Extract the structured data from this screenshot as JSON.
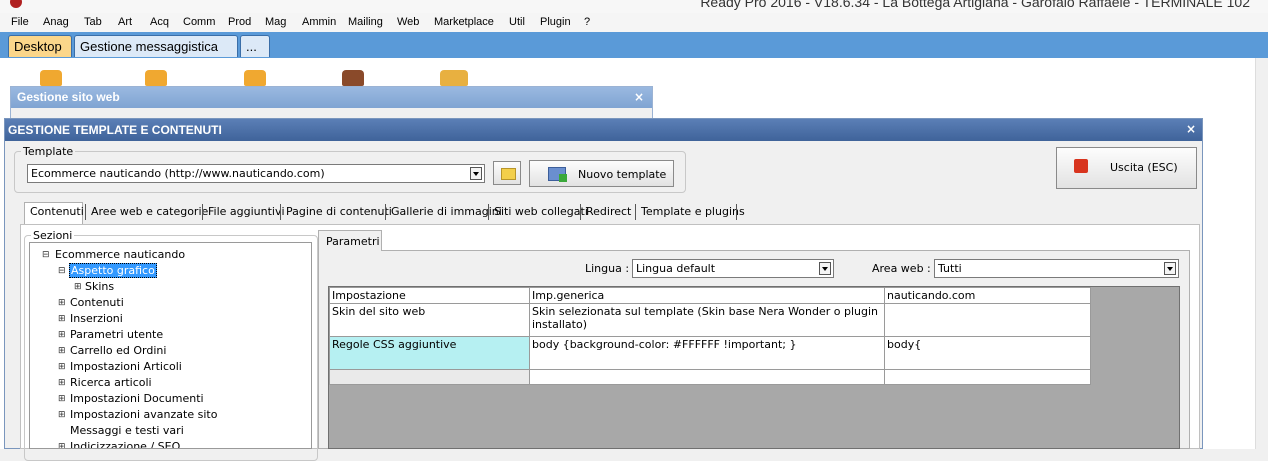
{
  "app": {
    "title": "Ready Pro 2016 - V18.6.34 - La Bottega Artigiana - Garofalo Raffaele - TERMINALE 102"
  },
  "menu": [
    "File",
    "Anag",
    "Tab",
    "Art",
    "Acq",
    "Comm",
    "Prod",
    "Mag",
    "Ammin",
    "Mailing",
    "Web",
    "Marketplace",
    "Util",
    "Plugin",
    "?"
  ],
  "tabs": [
    {
      "label": "Desktop",
      "active": true
    },
    {
      "label": "Gestione messaggistica",
      "active": false
    },
    {
      "label": "...",
      "active": false
    }
  ],
  "bg_window": {
    "title": "Gestione sito web",
    "close": "×"
  },
  "main_window": {
    "title": "GESTIONE TEMPLATE E CONTENUTI",
    "close": "×",
    "template_group": "Template",
    "template_value": "Ecommerce nauticando (http://www.nauticando.com)",
    "new_template_button": "Nuovo template",
    "exit_button": "Uscita (ESC)",
    "tabs": [
      "Contenuti",
      "Aree web e categorie",
      "File aggiuntivi",
      "Pagine di contenuti",
      "Gallerie di immagini",
      "Siti web collegati",
      "Redirect",
      "Template e plugins"
    ],
    "sections_group": "Sezioni",
    "tree": [
      {
        "label": "Ecommerce nauticando",
        "level": 0,
        "expander": "⊟"
      },
      {
        "label": "Aspetto grafico",
        "level": 1,
        "expander": "⊟",
        "selected": true
      },
      {
        "label": "Skins",
        "level": 2,
        "expander": "⊞"
      },
      {
        "label": "Contenuti",
        "level": 1,
        "expander": "⊞"
      },
      {
        "label": "Inserzioni",
        "level": 1,
        "expander": "⊞"
      },
      {
        "label": "Parametri utente",
        "level": 1,
        "expander": "⊞"
      },
      {
        "label": "Carrello ed Ordini",
        "level": 1,
        "expander": "⊞"
      },
      {
        "label": "Impostazioni Articoli",
        "level": 1,
        "expander": "⊞"
      },
      {
        "label": "Ricerca articoli",
        "level": 1,
        "expander": "⊞"
      },
      {
        "label": "Impostazioni Documenti",
        "level": 1,
        "expander": "⊞"
      },
      {
        "label": "Impostazioni avanzate sito",
        "level": 1,
        "expander": "⊞"
      },
      {
        "label": "Messaggi e testi vari",
        "level": 1,
        "expander": ""
      },
      {
        "label": "Indicizzazione / SEO",
        "level": 1,
        "expander": "⊞"
      }
    ],
    "params_tab": "Parametri",
    "lingua_label": "Lingua :",
    "lingua_value": "Lingua default",
    "area_label": "Area web :",
    "area_value": "Tutti",
    "grid": {
      "headers": [
        "Impostazione",
        "Imp.generica",
        "nauticando.com"
      ],
      "rows": [
        [
          "Skin del sito web",
          "Skin selezionata sul template (Skin base Nera Wonder o plugin installato)",
          ""
        ],
        [
          "Regole CSS aggiuntive",
          "body {background-color: #FFFFFF !important; }",
          "body{"
        ],
        [
          "",
          "",
          ""
        ]
      ]
    }
  },
  "colors": {
    "accent": "#3f639a",
    "highlight": "#b6f0f2",
    "selected_bg": "#3399ff",
    "tab_bar": "#5a9ad8"
  }
}
